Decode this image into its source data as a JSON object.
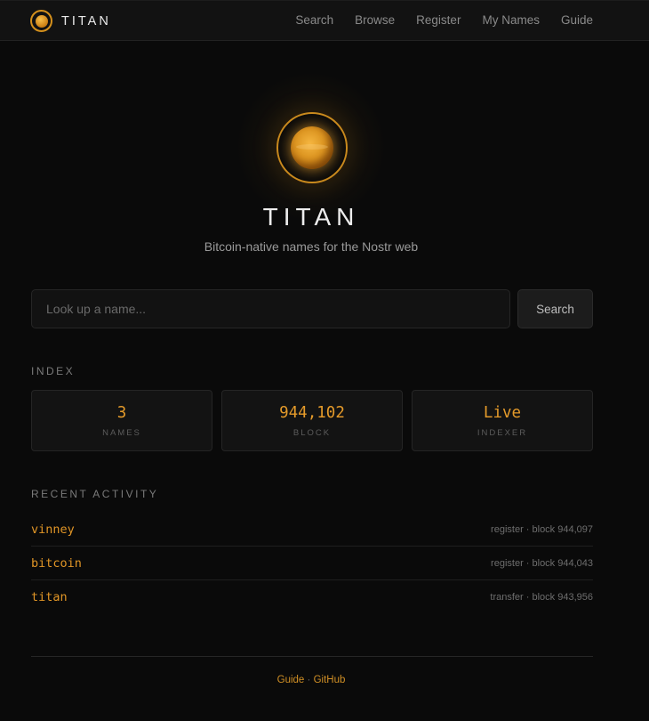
{
  "nav": {
    "brand": "TITAN",
    "links": [
      "Search",
      "Browse",
      "Register",
      "My Names",
      "Guide"
    ]
  },
  "hero": {
    "title": "TITAN",
    "subtitle": "Bitcoin-native names for the Nostr web"
  },
  "search": {
    "placeholder": "Look up a name...",
    "button": "Search"
  },
  "index": {
    "label": "INDEX",
    "stats": [
      {
        "value": "3",
        "label": "NAMES"
      },
      {
        "value": "944,102",
        "label": "BLOCK"
      },
      {
        "value": "Live",
        "label": "INDEXER"
      }
    ]
  },
  "activity": {
    "label": "RECENT ACTIVITY",
    "items": [
      {
        "name": "vinney",
        "meta": "register · block 944,097"
      },
      {
        "name": "bitcoin",
        "meta": "register · block 944,043"
      },
      {
        "name": "titan",
        "meta": "transfer · block 943,956"
      }
    ]
  },
  "footer": {
    "guide": "Guide",
    "separator": "·",
    "github": "GitHub"
  },
  "colors": {
    "accent": "#e09526",
    "background": "#0a0a0a"
  }
}
